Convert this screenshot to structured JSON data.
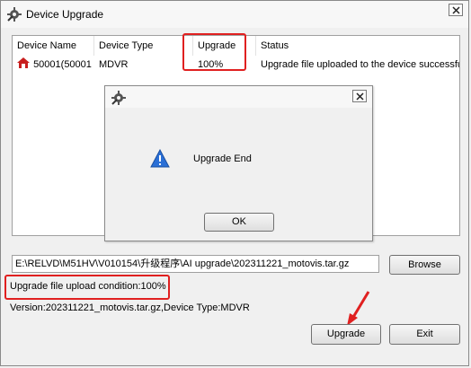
{
  "window": {
    "title": "Device Upgrade",
    "app_icon": "gear-wrench-icon",
    "close_icon": "close-icon"
  },
  "list": {
    "headers": [
      "Device Name",
      "Device Type",
      "Upgrade",
      "Status"
    ],
    "rows": [
      {
        "icon": "house-device-icon",
        "name": "50001(50001",
        "type": "MDVR",
        "upgrade": "100%",
        "status": "Upgrade file uploaded to the device successful"
      }
    ]
  },
  "dialog": {
    "message": "Upgrade End",
    "ok_label": "OK",
    "icon": "warning-icon",
    "app_icon": "gear-wrench-icon",
    "close_icon": "close-icon"
  },
  "file_path": "E:\\RELVD\\M51HV\\V010154\\升级程序\\AI upgrade\\202311221_motovis.tar.gz",
  "browse_label": "Browse",
  "upload_condition": "Upgrade file upload condition:100%",
  "version_info": "Version:202311221_motovis.tar.gz,Device Type:MDVR",
  "upgrade_label": "Upgrade",
  "exit_label": "Exit",
  "annotation_color": "#e02020"
}
